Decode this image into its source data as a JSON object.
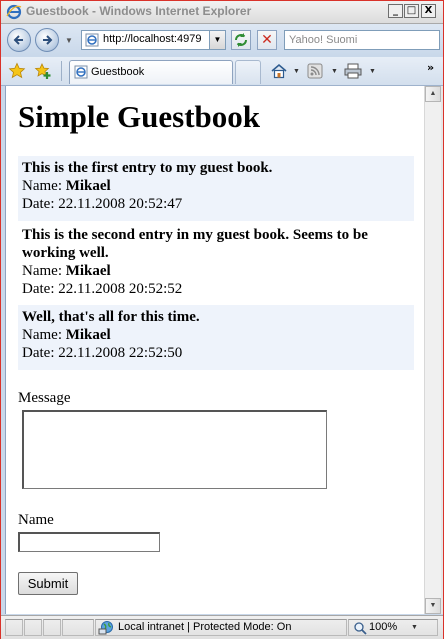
{
  "window": {
    "title": "Guestbook - Windows Internet Explorer",
    "buttons": {
      "minimize": "_",
      "maximize": "□",
      "close": "X"
    }
  },
  "address_bar": {
    "url": "http://localhost:4979",
    "search_placeholder": "Yahoo! Suomi"
  },
  "tabs": [
    {
      "label": "Guestbook",
      "active": true
    }
  ],
  "page": {
    "heading": "Simple Guestbook",
    "entries": [
      {
        "message": "This is the first entry to my guest book.",
        "name_label": "Name:",
        "name": "Mikael",
        "date_label": "Date:",
        "date": "22.11.2008 20:52:47",
        "shaded": true
      },
      {
        "message": "This is the second entry in my guest book. Seems to be working well.",
        "name_label": "Name:",
        "name": "Mikael",
        "date_label": "Date:",
        "date": "22.11.2008 20:52:52",
        "shaded": false
      },
      {
        "message": "Well, that's all for this time.",
        "name_label": "Name:",
        "name": "Mikael",
        "date_label": "Date:",
        "date": "22.11.2008 22:52:50",
        "shaded": true
      }
    ],
    "form": {
      "message_label": "Message",
      "message_value": "",
      "name_label": "Name",
      "name_value": "",
      "submit_label": "Submit"
    }
  },
  "status_bar": {
    "zone": "Local intranet | Protected Mode: On",
    "zoom": "100%"
  },
  "colors": {
    "entry_shade": "#eef3fb",
    "window_border": "#d9322a"
  }
}
